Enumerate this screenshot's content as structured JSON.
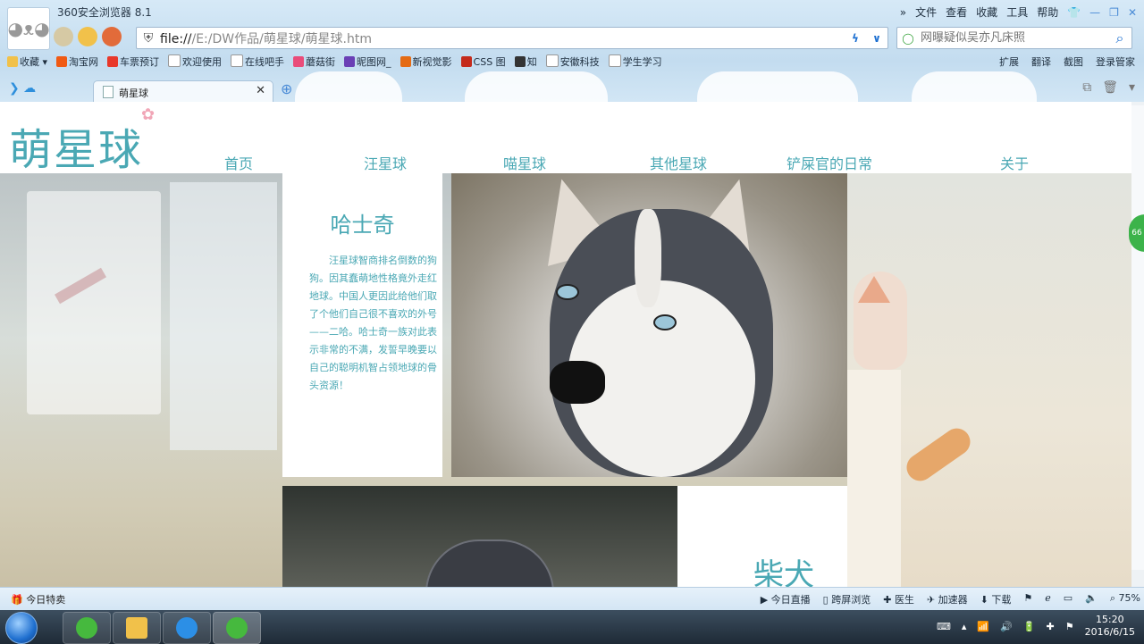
{
  "browser": {
    "title": "360安全浏览器 8.1",
    "menu": [
      "文件",
      "查看",
      "收藏",
      "工具",
      "帮助"
    ],
    "address": {
      "scheme": "file://",
      "path": "/E:/DW作品/萌星球/萌星球.htm"
    },
    "search_placeholder": "网曝疑似吴亦凡床照",
    "bookmarks": [
      "收藏",
      "淘宝网",
      "车票预订",
      "欢迎使用",
      "在线吧手",
      "蘑菇街",
      "昵图网_",
      "新视觉影",
      "CSS 图",
      "知",
      "安徽科技",
      "学生学习"
    ],
    "tools_right": [
      "扩展",
      "翻译",
      "截图",
      "登录管家"
    ],
    "tab_label": "萌星球"
  },
  "site": {
    "logo": "萌星球",
    "nav": [
      "首页",
      "汪星球",
      "喵星球",
      "其他星球",
      "铲屎官的日常",
      "关于"
    ],
    "card1": {
      "title": "哈士奇",
      "text": "汪星球智商排名倒数的狗狗。因其蠢萌地性格竟外走红地球。中国人更因此给他们取了个他们自己很不喜欢的外号——二哈。哈士奇一族对此表示非常的不满，发誓早晚要以自己的聪明机智占领地球的骨头资源！"
    },
    "card2": {
      "title": "柴犬"
    }
  },
  "status": {
    "left": "今日特卖",
    "right": [
      "今日直播",
      "跨屏浏览",
      "医生",
      "加速器",
      "下载",
      "75%"
    ]
  },
  "taskbar": {
    "time": "15:20",
    "date": "2016/6/15",
    "side_badge": "66"
  }
}
